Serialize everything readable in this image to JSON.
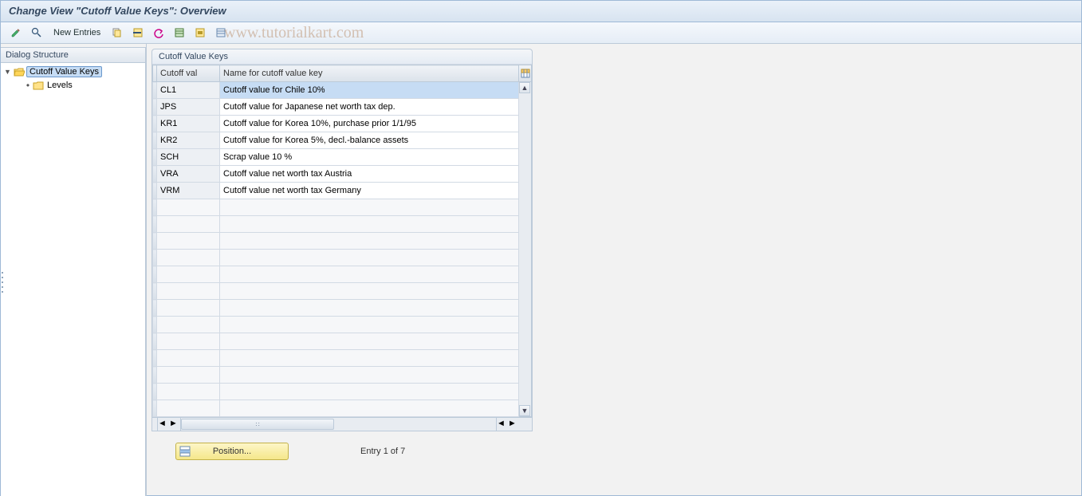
{
  "title": "Change View \"Cutoff Value Keys\": Overview",
  "watermark": "www.tutorialkart.com",
  "toolbar": {
    "new_entries": "New Entries"
  },
  "tree": {
    "header": "Dialog Structure",
    "root": "Cutoff Value Keys",
    "child": "Levels"
  },
  "group_title": "Cutoff Value Keys",
  "columns": {
    "key": "Cutoff val",
    "name": "Name for cutoff value key"
  },
  "rows": [
    {
      "key": "CL1",
      "name": "Cutoff value for Chile 10%"
    },
    {
      "key": "JPS",
      "name": "Cutoff value for Japanese net worth tax dep."
    },
    {
      "key": "KR1",
      "name": "Cutoff value for Korea 10%, purchase prior 1/1/95"
    },
    {
      "key": "KR2",
      "name": "Cutoff value for Korea 5%, decl.-balance assets"
    },
    {
      "key": "SCH",
      "name": "Scrap value 10 %"
    },
    {
      "key": "VRA",
      "name": "Cutoff value net worth tax Austria"
    },
    {
      "key": "VRM",
      "name": "Cutoff value net worth tax Germany"
    }
  ],
  "empty_rows": 13,
  "position_label": "Position...",
  "entry_text": "Entry 1 of 7"
}
